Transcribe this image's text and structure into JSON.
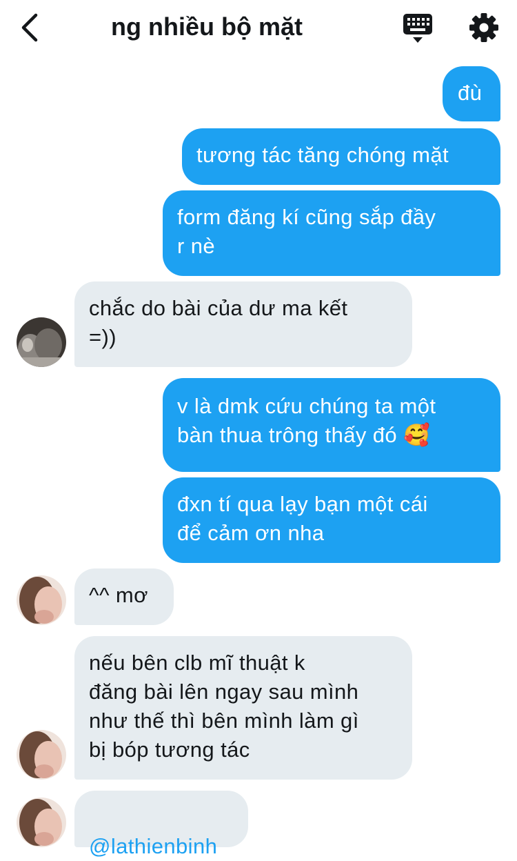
{
  "header": {
    "title": "ng nhiều bộ mặt",
    "back_icon": "chevron-left-icon",
    "keyboard_icon": "keyboard-icon",
    "settings_icon": "gear-icon"
  },
  "colors": {
    "sent_bubble": "#1da1f2",
    "received_bubble": "#e6ecf0",
    "link": "#1da1f2",
    "text_dark": "#14171a"
  },
  "messages": [
    {
      "direction": "sent",
      "text": "đù"
    },
    {
      "direction": "sent",
      "text": "tương tác tăng chóng mặt"
    },
    {
      "direction": "sent",
      "text": "form đăng kí cũng sắp đầy\nr nè"
    },
    {
      "direction": "received",
      "text": "chắc do bài của dư ma kết\n=))"
    },
    {
      "direction": "sent",
      "text": "v là dmk cứu chúng ta một\nbàn thua trông thấy đó 🥰"
    },
    {
      "direction": "sent",
      "text": "đxn tí qua lạy bạn một cái\nđể cảm ơn nha"
    },
    {
      "direction": "received",
      "text": "^^ mơ"
    },
    {
      "direction": "received",
      "text": "nếu bên clb mĩ thuật k\nđăng bài lên ngay sau mình\nnhư thế thì bên mình làm gì\nbị bóp tương tác"
    },
    {
      "direction": "received",
      "text": "@lathienbinh"
    }
  ]
}
